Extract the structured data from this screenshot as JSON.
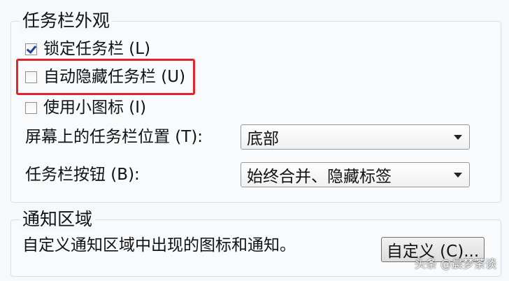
{
  "appearance": {
    "title": "任务栏外观",
    "lock_taskbar": {
      "label": "锁定任务栏 (L)",
      "checked": true
    },
    "auto_hide": {
      "label": "自动隐藏任务栏 (U)",
      "checked": false
    },
    "small_icons": {
      "label": "使用小图标 (I)",
      "checked": false
    },
    "location": {
      "label": "屏幕上的任务栏位置 (T):",
      "value": "底部"
    },
    "buttons": {
      "label": "任务栏按钮 (B):",
      "value": "始终合并、隐藏标签"
    }
  },
  "notification": {
    "title": "通知区域",
    "description": "自定义通知区域中出现的图标和通知。",
    "customize_label": "自定义 (C)..."
  },
  "watermark": "头条 @晨梦茶谈",
  "colors": {
    "highlight": "#e3242b",
    "check": "#1c3ea8"
  }
}
